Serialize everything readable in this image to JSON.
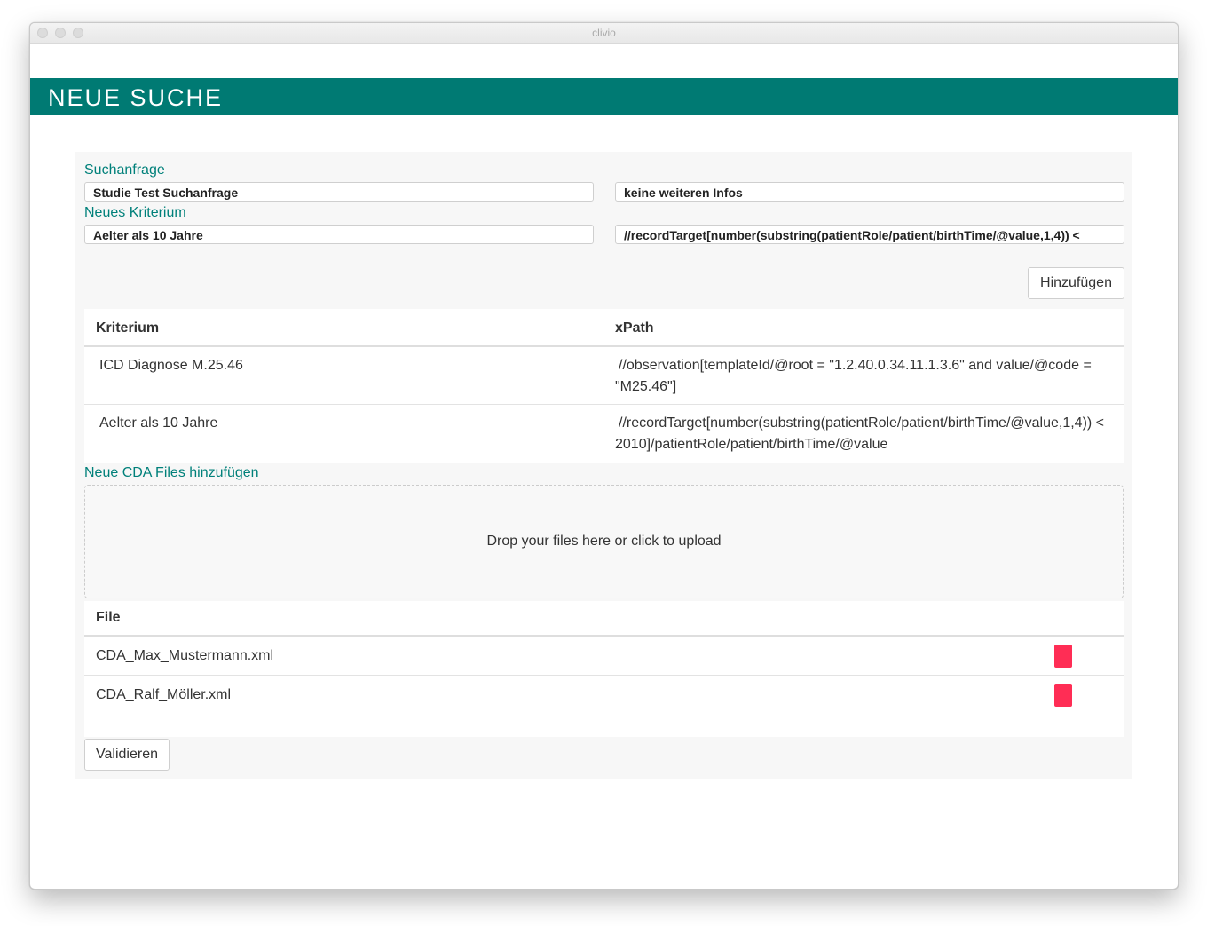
{
  "window": {
    "title": "clivio"
  },
  "header": {
    "title": "NEUE SUCHE"
  },
  "form": {
    "query_label": "Suchanfrage",
    "query_name": "Studie Test Suchanfrage",
    "query_info": "keine weiteren Infos",
    "criterion_label": "Neues Kriterium",
    "criterion_name": "Aelter als 10 Jahre",
    "criterion_xpath": "//recordTarget[number(substring(patientRole/patient/birthTime/@value,1,4)) <",
    "add_button": "Hinzufügen"
  },
  "criteria_table": {
    "columns": [
      "Kriterium",
      "xPath"
    ],
    "rows": [
      {
        "kriterium": "ICD Diagnose M.25.46",
        "xpath_line1": "//observation[templateId/@root = \"1.2.40.0.34.11.1.3.6\" and value/@code =",
        "xpath_line2": "\"M25.46\"]"
      },
      {
        "kriterium": "Aelter als 10 Jahre",
        "xpath_line1": "//recordTarget[number(substring(patientRole/patient/birthTime/@value,1,4)) <",
        "xpath_line2": "2010]/patientRole/patient/birthTime/@value"
      }
    ]
  },
  "files": {
    "label": "Neue CDA Files hinzufügen",
    "dropzone_text": "Drop your files here or click to upload",
    "column": "File",
    "rows": [
      {
        "name": "CDA_Max_Mustermann.xml"
      },
      {
        "name": "CDA_Ralf_Möller.xml"
      }
    ],
    "delete_color": "#ff2d55"
  },
  "actions": {
    "validate_button": "Validieren"
  },
  "colors": {
    "accent": "#007a73",
    "label": "#00807a"
  }
}
